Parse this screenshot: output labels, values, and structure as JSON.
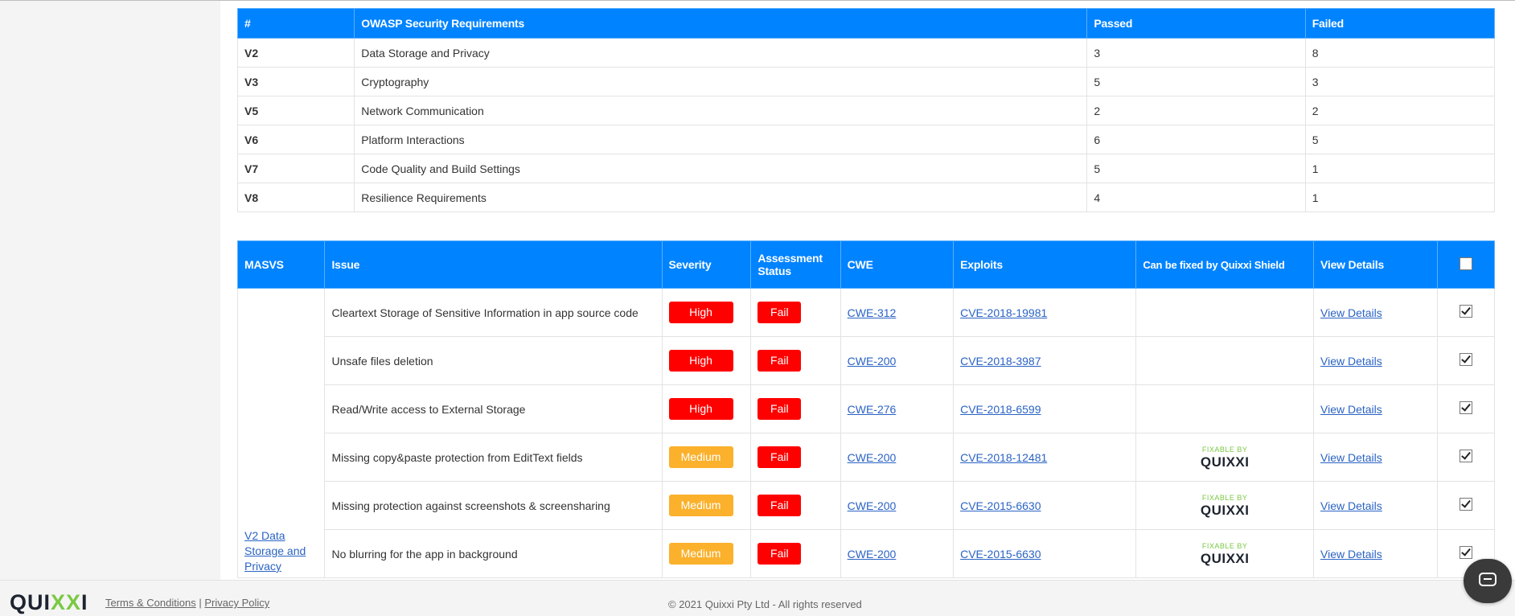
{
  "owasp_table": {
    "headers": [
      "#",
      "OWASP Security Requirements",
      "Passed",
      "Failed"
    ],
    "rows": [
      {
        "id": "V2",
        "name": "Data Storage and Privacy",
        "passed": "3",
        "failed": "8"
      },
      {
        "id": "V3",
        "name": "Cryptography",
        "passed": "5",
        "failed": "3"
      },
      {
        "id": "V5",
        "name": "Network Communication",
        "passed": "2",
        "failed": "2"
      },
      {
        "id": "V6",
        "name": "Platform Interactions",
        "passed": "6",
        "failed": "5"
      },
      {
        "id": "V7",
        "name": "Code Quality and Build Settings",
        "passed": "5",
        "failed": "1"
      },
      {
        "id": "V8",
        "name": "Resilience Requirements",
        "passed": "4",
        "failed": "1"
      }
    ]
  },
  "issues_table": {
    "headers": {
      "masvs": "MASVS",
      "issue": "Issue",
      "severity": "Severity",
      "assessment_line1": "Assessment",
      "assessment_line2": "Status",
      "cwe": "CWE",
      "exploits": "Exploits",
      "fixable": "Can be fixed by Quixxi Shield",
      "view": "View Details"
    },
    "header_checkbox_checked": false,
    "masvs_group_link": "V2 Data Storage and Privacy",
    "fixable_badge": {
      "line1": "FIXABLE BY",
      "line2": "QUIXXI"
    },
    "rows": [
      {
        "issue": "Cleartext Storage of Sensitive Information in app source code",
        "severity": "High",
        "status": "Fail",
        "cwe": "CWE-312",
        "exploit": "CVE-2018-19981",
        "fixable": false,
        "view": "View Details",
        "checked": true
      },
      {
        "issue": "Unsafe files deletion",
        "severity": "High",
        "status": "Fail",
        "cwe": "CWE-200",
        "exploit": "CVE-2018-3987",
        "fixable": false,
        "view": "View Details",
        "checked": true
      },
      {
        "issue": "Read/Write access to External Storage",
        "severity": "High",
        "status": "Fail",
        "cwe": "CWE-276",
        "exploit": "CVE-2018-6599",
        "fixable": false,
        "view": "View Details",
        "checked": true
      },
      {
        "issue": "Missing copy&paste protection from EditText fields",
        "severity": "Medium",
        "status": "Fail",
        "cwe": "CWE-200",
        "exploit": "CVE-2018-12481",
        "fixable": true,
        "view": "View Details",
        "checked": true
      },
      {
        "issue": "Missing protection against screenshots & screensharing",
        "severity": "Medium",
        "status": "Fail",
        "cwe": "CWE-200",
        "exploit": "CVE-2015-6630",
        "fixable": true,
        "view": "View Details",
        "checked": true
      },
      {
        "issue": "No blurring for the app in background",
        "severity": "Medium",
        "status": "Fail",
        "cwe": "CWE-200",
        "exploit": "CVE-2015-6630",
        "fixable": true,
        "view": "View Details",
        "checked": true
      }
    ]
  },
  "colors": {
    "header_blue": "#0083ff",
    "high": "#ff0000",
    "medium": "#fbb12c",
    "fail": "#ff0000",
    "link": "#2a63c4",
    "brand_green": "#7ac943"
  },
  "footer": {
    "logo": "QUIXXI",
    "terms": "Terms & Conditions",
    "separator": "|",
    "privacy": "Privacy Policy",
    "copyright": "© 2021 Quixxi Pty Ltd - All rights reserved"
  },
  "chat_icon": "chat-bubble-icon"
}
